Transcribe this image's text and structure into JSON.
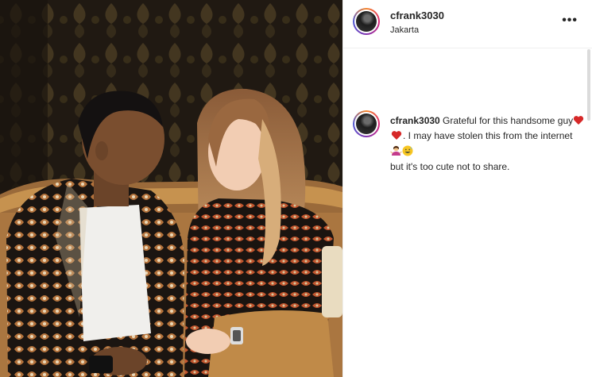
{
  "post": {
    "author": {
      "username": "cfrank3030",
      "location": "Jakarta"
    },
    "more_label": "•••",
    "caption": {
      "username": "cfrank3030",
      "text_part1": " Grateful for this handsome guy",
      "text_part2": ". I may have stolen this from the internet ",
      "text_part3": " but it's too cute not to share.",
      "emojis": [
        "heart-emoji",
        "heart-emoji",
        "woman-shrugging-emoji",
        "grinning-sweat-emoji"
      ]
    }
  }
}
